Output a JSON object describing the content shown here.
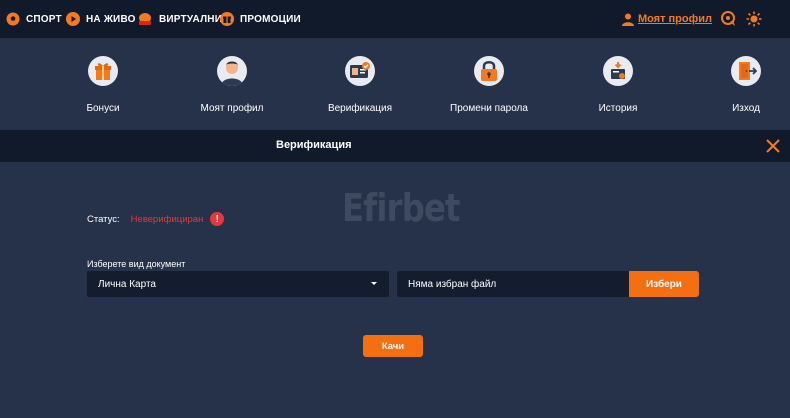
{
  "topnav": {
    "items": [
      {
        "label": "СПОРТ",
        "icon": "football-icon"
      },
      {
        "label": "НА ЖИВО",
        "icon": "play-icon"
      },
      {
        "label": "ВИРТУАЛНИ",
        "icon": "virtual-icon"
      },
      {
        "label": "ПРОМОЦИИ",
        "icon": "gift-icon"
      }
    ],
    "profile_link": "Моят профил"
  },
  "menu": {
    "items": [
      {
        "label": "Бонуси",
        "icon": "gift-box-icon"
      },
      {
        "label": "Моят профил",
        "icon": "user-avatar-icon"
      },
      {
        "label": "Верификация",
        "icon": "id-card-icon"
      },
      {
        "label": "Промени парола",
        "icon": "padlock-icon"
      },
      {
        "label": "История",
        "icon": "history-icon"
      },
      {
        "label": "Изход",
        "icon": "logout-icon"
      }
    ]
  },
  "section": {
    "title": "Верификация"
  },
  "watermark": "Efirbet",
  "status": {
    "label": "Статус:",
    "value": "Неверифициран",
    "warn": "!"
  },
  "document": {
    "label": "Изберете вид документ",
    "selected": "Лична Карта",
    "file_placeholder": "Няма избран файл",
    "choose_label": "Избери",
    "upload_label": "Качи"
  },
  "colors": {
    "accent": "#f46e12",
    "error": "#e5383b",
    "bg": "#263249",
    "bar": "#111a2b"
  }
}
